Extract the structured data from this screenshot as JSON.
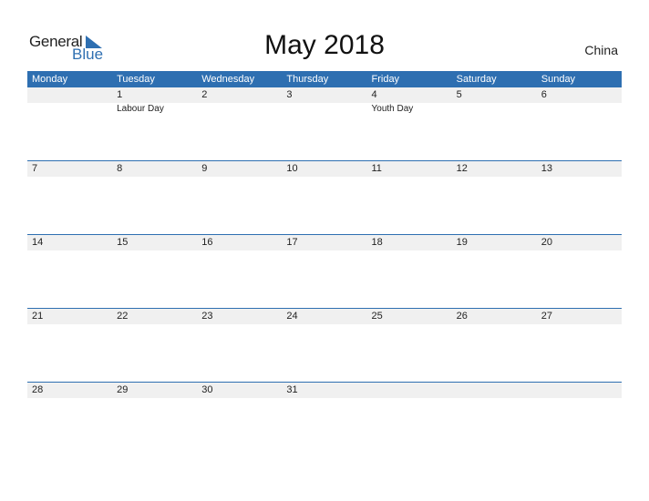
{
  "logo": {
    "general": "General",
    "blue": "Blue"
  },
  "title": "May 2018",
  "country": "China",
  "colors": {
    "accent": "#2e6fb1",
    "strip": "#f0f0f0"
  },
  "weekdays": [
    "Monday",
    "Tuesday",
    "Wednesday",
    "Thursday",
    "Friday",
    "Saturday",
    "Sunday"
  ],
  "weeks": [
    [
      {
        "d": ""
      },
      {
        "d": "1",
        "h": "Labour Day"
      },
      {
        "d": "2"
      },
      {
        "d": "3"
      },
      {
        "d": "4",
        "h": "Youth Day"
      },
      {
        "d": "5"
      },
      {
        "d": "6"
      }
    ],
    [
      {
        "d": "7"
      },
      {
        "d": "8"
      },
      {
        "d": "9"
      },
      {
        "d": "10"
      },
      {
        "d": "11"
      },
      {
        "d": "12"
      },
      {
        "d": "13"
      }
    ],
    [
      {
        "d": "14"
      },
      {
        "d": "15"
      },
      {
        "d": "16"
      },
      {
        "d": "17"
      },
      {
        "d": "18"
      },
      {
        "d": "19"
      },
      {
        "d": "20"
      }
    ],
    [
      {
        "d": "21"
      },
      {
        "d": "22"
      },
      {
        "d": "23"
      },
      {
        "d": "24"
      },
      {
        "d": "25"
      },
      {
        "d": "26"
      },
      {
        "d": "27"
      }
    ],
    [
      {
        "d": "28"
      },
      {
        "d": "29"
      },
      {
        "d": "30"
      },
      {
        "d": "31"
      },
      {
        "d": ""
      },
      {
        "d": ""
      },
      {
        "d": ""
      }
    ]
  ]
}
